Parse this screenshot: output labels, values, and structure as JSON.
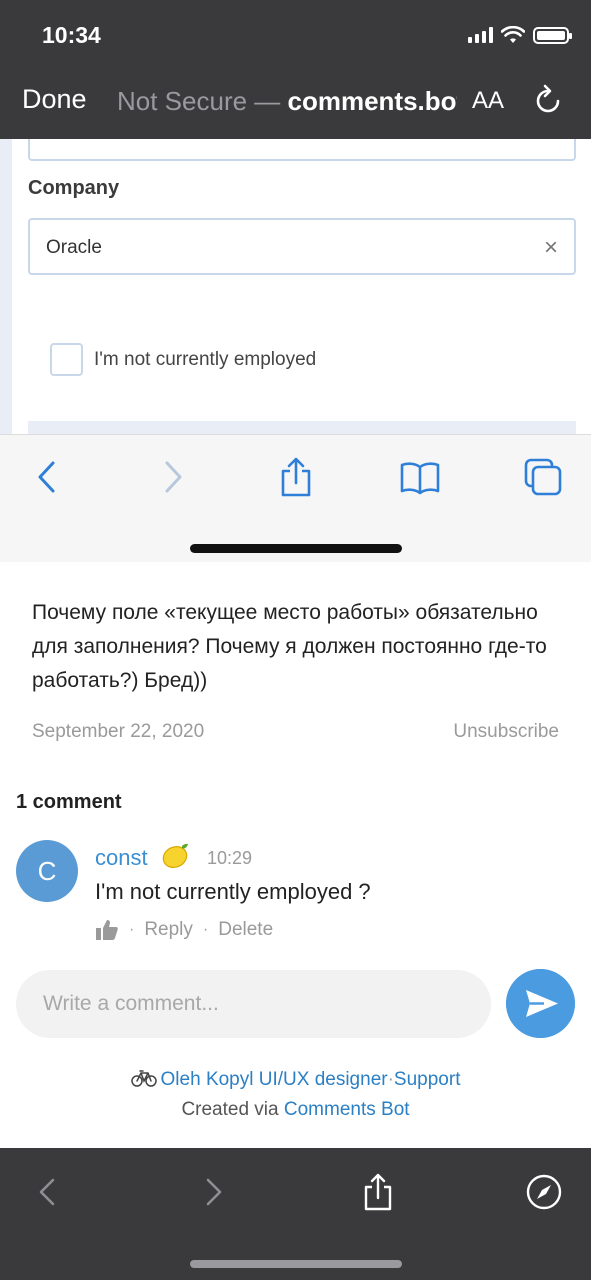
{
  "status_bar": {
    "time": "10:34"
  },
  "browser": {
    "done_label": "Done",
    "security_label": "Not Secure — ",
    "host": "comments.bot",
    "text_size_label": "AA"
  },
  "web_form": {
    "company_label": "Company",
    "company_value": "Oracle",
    "clear_glyph": "×",
    "checkbox_label": "I'm not currently employed",
    "checkbox_checked": false
  },
  "post": {
    "text": "Почему поле «текущее место работы» обязательно для заполнения? Почему я должен постоянно где-то работать?) Бред))",
    "date": "September 22, 2020",
    "unsubscribe_label": "Unsubscribe"
  },
  "comments": {
    "count_label": "1 comment",
    "items": [
      {
        "avatar_letter": "C",
        "author": "const",
        "author_emoji": "lemon-icon",
        "time": "10:29",
        "text": "I'm not currently employed ?",
        "reply_label": "Reply",
        "delete_label": "Delete"
      }
    ]
  },
  "composer": {
    "placeholder": "Write a comment..."
  },
  "footer": {
    "channel_name": "Oleh Kopyl UI/UX designer",
    "separator": "·",
    "support_label": "Support",
    "created_via": "Created via",
    "bot_name": "Comments Bot"
  },
  "colors": {
    "accent": "#3b8fd1",
    "avatar": "#5b9bd5",
    "send_button": "#4a9be0",
    "chrome_dark": "#3a3a3c"
  }
}
